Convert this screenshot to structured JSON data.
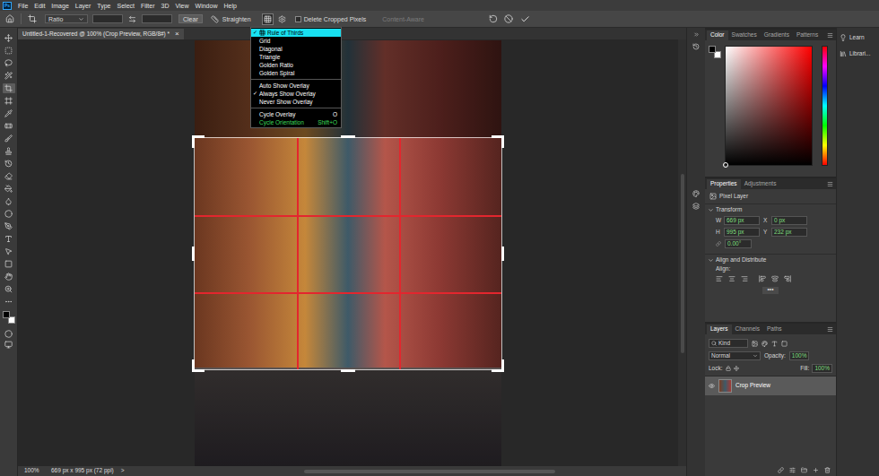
{
  "app": {
    "logo": "Ps"
  },
  "menu_bar": [
    "File",
    "Edit",
    "Image",
    "Layer",
    "Type",
    "Select",
    "Filter",
    "3D",
    "View",
    "Window",
    "Help"
  ],
  "options_bar": {
    "ratio": "Ratio",
    "clear": "Clear",
    "straighten": "Straighten",
    "overlay_menu_open": true,
    "delete_cropped_pixels": {
      "label": "Delete Cropped Pixels",
      "checked": false
    },
    "content_aware": {
      "label": "Content-Aware",
      "disabled": true
    }
  },
  "overlay_menu": {
    "check_mark": "✓",
    "groups": [
      [
        {
          "label": "Rule of Thirds",
          "checked": true,
          "selected": true,
          "shortcut": "",
          "color": "#000000"
        },
        {
          "label": "Grid",
          "checked": false,
          "selected": false,
          "shortcut": "",
          "color": "#ffffff"
        },
        {
          "label": "Diagonal",
          "checked": false,
          "selected": false,
          "shortcut": "",
          "color": "#ffffff"
        },
        {
          "label": "Triangle",
          "checked": false,
          "selected": false,
          "shortcut": "",
          "color": "#ffffff"
        },
        {
          "label": "Golden Ratio",
          "checked": false,
          "selected": false,
          "shortcut": "",
          "color": "#ffffff"
        },
        {
          "label": "Golden Spiral",
          "checked": false,
          "selected": false,
          "shortcut": "",
          "color": "#ffffff"
        }
      ],
      [
        {
          "label": "Auto Show Overlay",
          "checked": false,
          "selected": false,
          "shortcut": "",
          "color": "#ffffff"
        },
        {
          "label": "Always Show Overlay",
          "checked": true,
          "selected": false,
          "shortcut": "",
          "color": "#ffffff"
        },
        {
          "label": "Never Show Overlay",
          "checked": false,
          "selected": false,
          "shortcut": "",
          "color": "#ffffff"
        }
      ],
      [
        {
          "label": "Cycle Overlay",
          "checked": false,
          "selected": false,
          "shortcut": "O",
          "color": "#ffffff"
        },
        {
          "label": "Cycle Orientation",
          "checked": false,
          "selected": false,
          "shortcut": "Shift+O",
          "color": "#3ddc5a"
        }
      ]
    ]
  },
  "document_tab": {
    "title": "Untitled-1-Recovered @ 100% (Crop Preview, RGB/8#) *",
    "close": "×"
  },
  "tools": [
    {
      "selected": false
    },
    {
      "selected": false
    },
    {
      "selected": false
    },
    {
      "selected": false
    },
    {
      "selected": true
    },
    {
      "selected": false
    },
    {
      "selected": false
    },
    {
      "selected": false
    },
    {
      "selected": false
    },
    {
      "selected": false
    },
    {
      "selected": false
    },
    {
      "selected": false
    },
    {
      "selected": false
    },
    {
      "selected": false
    },
    {
      "selected": false
    },
    {
      "selected": false
    },
    {
      "selected": false
    },
    {
      "selected": false
    },
    {
      "selected": false
    },
    {
      "selected": false
    },
    {
      "selected": false
    },
    {
      "selected": false
    }
  ],
  "tool_colors": {
    "foreground": "#000000",
    "background": "#ffffff"
  },
  "color_panel": {
    "tabs": [
      {
        "label": "Color",
        "selected": true
      },
      {
        "label": "Swatches",
        "selected": false
      },
      {
        "label": "Gradients",
        "selected": false
      },
      {
        "label": "Patterns",
        "selected": false
      }
    ],
    "hue": "#ff0000",
    "foreground": "#000000",
    "background": "#ffffff"
  },
  "properties": {
    "tabs": [
      {
        "label": "Properties",
        "selected": true
      },
      {
        "label": "Adjustments",
        "selected": false
      }
    ],
    "layer_kind": "Pixel Layer",
    "transform": {
      "title": "Transform",
      "expanded": true,
      "w_label": "W",
      "w": "669 px",
      "x_label": "X",
      "x": "0 px",
      "h_label": "H",
      "h": "995 px",
      "y_label": "Y",
      "y": "232 px",
      "angle": "0.00°"
    },
    "align": {
      "title": "Align and Distribute",
      "expanded": true,
      "label": "Align:"
    },
    "more": "•••"
  },
  "layers": {
    "tabs": [
      {
        "label": "Layers",
        "selected": true
      },
      {
        "label": "Channels",
        "selected": false
      },
      {
        "label": "Paths",
        "selected": false
      }
    ],
    "filter": "Kind",
    "blend_mode": "Normal",
    "opacity_label": "Opacity:",
    "opacity": "100%",
    "lock_label": "Lock:",
    "fill_label": "Fill:",
    "fill": "100%",
    "items": [
      {
        "name": "Crop Preview",
        "visible": true,
        "selected": true
      }
    ]
  },
  "side_panels": [
    {
      "label": "Learn"
    },
    {
      "label": "Librari..."
    }
  ],
  "status_bar": {
    "zoom": "100%",
    "info": "669 px x 995 px (72 ppi)",
    "arrow": ">"
  }
}
